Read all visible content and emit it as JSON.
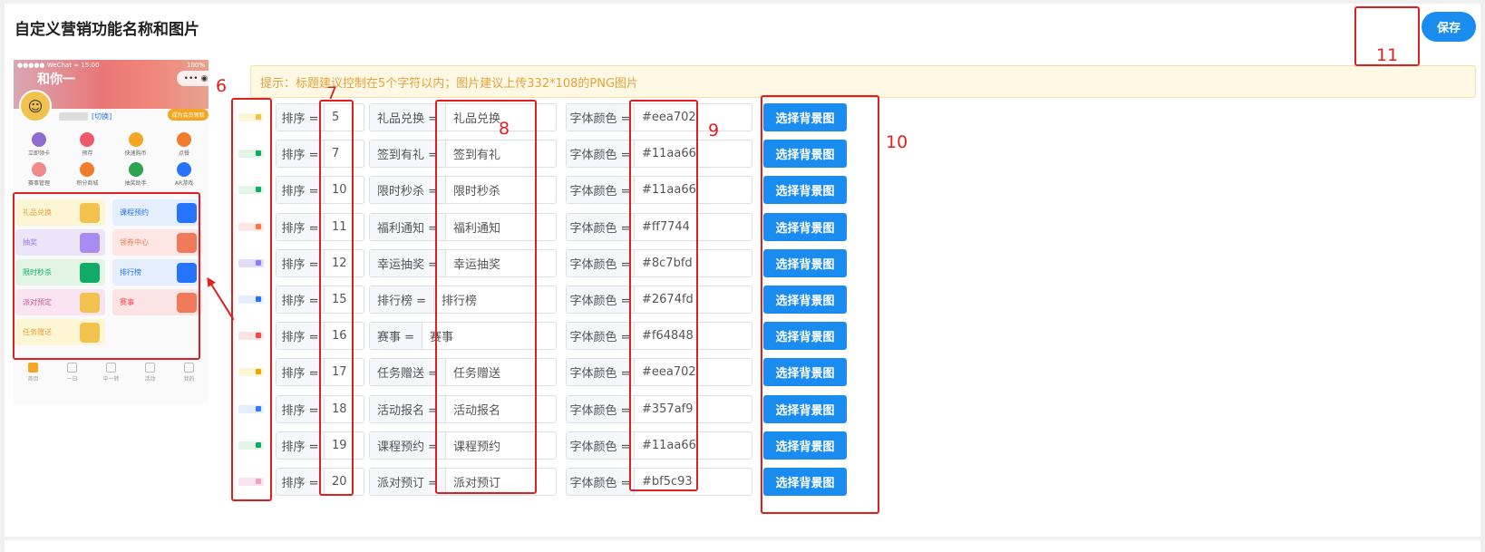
{
  "page": {
    "title": "自定义营销功能名称和图片",
    "save_label": "保存",
    "tip": "提示：标题建议控制在5个字符以内；图片建议上传332*108的PNG图片"
  },
  "phone": {
    "status_left": "●●●●● WeChat ≈ 15:00",
    "status_right": "100%",
    "brand": "和你一",
    "capsule": "•••  ◉",
    "switch": "[切换]",
    "vip": "成为会员领取",
    "grid": [
      [
        {
          "label": "立即领卡",
          "color": "#8e6bd1"
        },
        {
          "label": "预存",
          "color": "#ef5a6b"
        },
        {
          "label": "快速购币",
          "color": "#f5a623"
        },
        {
          "label": "点餐",
          "color": "#f27c2e"
        }
      ],
      [
        {
          "label": "赛事管理",
          "color": "#f08a8a"
        },
        {
          "label": "积分商城",
          "color": "#f27c2e"
        },
        {
          "label": "抽奖助手",
          "color": "#2ea44f"
        },
        {
          "label": "AR游戏",
          "color": "#2674fd"
        }
      ]
    ],
    "cards": [
      [
        {
          "label": "礼品兑换",
          "bg": "#fdf6d5",
          "color": "#e6a23c",
          "icon": "#f2c14e"
        },
        {
          "label": "课程预约",
          "bg": "#e4eefc",
          "color": "#2674fd",
          "icon": "#2674fd"
        }
      ],
      [
        {
          "label": "抽奖",
          "bg": "#ece4f8",
          "color": "#8c7bfd",
          "icon": "#a78bf0"
        },
        {
          "label": "领券中心",
          "bg": "#fde6e3",
          "color": "#f07a5a",
          "icon": "#f07a5a"
        }
      ],
      [
        {
          "label": "限时秒杀",
          "bg": "#e3f5e5",
          "color": "#11aa66",
          "icon": "#11aa66"
        },
        {
          "label": "排行榜",
          "bg": "#e4eefc",
          "color": "#2674fd",
          "icon": "#2674fd"
        }
      ],
      [
        {
          "label": "派对预定",
          "bg": "#fbe4f2",
          "color": "#bf5c93",
          "icon": "#f2c14e"
        },
        {
          "label": "赛事",
          "bg": "#fde4e4",
          "color": "#f64848",
          "icon": "#f07a5a"
        }
      ],
      [
        {
          "label": "任务赠送",
          "bg": "#fdf6d5",
          "color": "#e6a23c",
          "icon": "#f2c14e"
        }
      ]
    ],
    "tabs": [
      {
        "label": "首页",
        "active": true
      },
      {
        "label": "一日",
        "active": false
      },
      {
        "label": "中一转",
        "active": false
      },
      {
        "label": "活动",
        "active": false
      },
      {
        "label": "我的",
        "active": false
      }
    ]
  },
  "rows": [
    {
      "sort_label": "排序 =",
      "sort": "5",
      "name_label": "礼品兑换 =",
      "name": "礼品兑换",
      "color_label": "字体颜色 =",
      "color": "#eea702",
      "button": "选择背景图",
      "thumb_bg": "#fdf6d5",
      "thumb_dot": "#f2c14e"
    },
    {
      "sort_label": "排序 =",
      "sort": "7",
      "name_label": "签到有礼 =",
      "name": "签到有礼",
      "color_label": "字体颜色 =",
      "color": "#11aa66",
      "button": "选择背景图",
      "thumb_bg": "#e3f5e5",
      "thumb_dot": "#11aa66"
    },
    {
      "sort_label": "排序 =",
      "sort": "10",
      "name_label": "限时秒杀 =",
      "name": "限时秒杀",
      "color_label": "字体颜色 =",
      "color": "#11aa66",
      "button": "选择背景图",
      "thumb_bg": "#e3f5e5",
      "thumb_dot": "#11aa66"
    },
    {
      "sort_label": "排序 =",
      "sort": "11",
      "name_label": "福利通知 =",
      "name": "福利通知",
      "color_label": "字体颜色 =",
      "color": "#ff7744",
      "button": "选择背景图",
      "thumb_bg": "#fde6e3",
      "thumb_dot": "#ff7744"
    },
    {
      "sort_label": "排序 =",
      "sort": "12",
      "name_label": "幸运抽奖 =",
      "name": "幸运抽奖",
      "color_label": "字体颜色 =",
      "color": "#8c7bfd",
      "button": "选择背景图",
      "thumb_bg": "#e2dcfb",
      "thumb_dot": "#8c7bfd"
    },
    {
      "sort_label": "排序 =",
      "sort": "15",
      "name_label": "排行榜 =",
      "name": "排行榜",
      "color_label": "字体颜色 =",
      "color": "#2674fd",
      "button": "选择背景图",
      "thumb_bg": "#e4eefc",
      "thumb_dot": "#2674fd"
    },
    {
      "sort_label": "排序 =",
      "sort": "16",
      "name_label": "赛事 =",
      "name": "赛事",
      "color_label": "字体颜色 =",
      "color": "#f64848",
      "button": "选择背景图",
      "thumb_bg": "#fde4e4",
      "thumb_dot": "#f64848"
    },
    {
      "sort_label": "排序 =",
      "sort": "17",
      "name_label": "任务赠送 =",
      "name": "任务赠送",
      "color_label": "字体颜色 =",
      "color": "#eea702",
      "button": "选择背景图",
      "thumb_bg": "#fdf6d5",
      "thumb_dot": "#eea702"
    },
    {
      "sort_label": "排序 =",
      "sort": "18",
      "name_label": "活动报名 =",
      "name": "活动报名",
      "color_label": "字体颜色 =",
      "color": "#357af9",
      "button": "选择背景图",
      "thumb_bg": "#e4eefc",
      "thumb_dot": "#357af9"
    },
    {
      "sort_label": "排序 =",
      "sort": "19",
      "name_label": "课程预约 =",
      "name": "课程预约",
      "color_label": "字体颜色 =",
      "color": "#11aa66",
      "button": "选择背景图",
      "thumb_bg": "#e3f5e5",
      "thumb_dot": "#11aa66"
    },
    {
      "sort_label": "排序 =",
      "sort": "20",
      "name_label": "派对预订 =",
      "name": "派对预订",
      "color_label": "字体颜色 =",
      "color": "#bf5c93",
      "button": "选择背景图",
      "thumb_bg": "#fbe4f2",
      "thumb_dot": "#f2a0c8"
    }
  ],
  "annotations": [
    "6",
    "7",
    "8",
    "9",
    "10",
    "11"
  ]
}
